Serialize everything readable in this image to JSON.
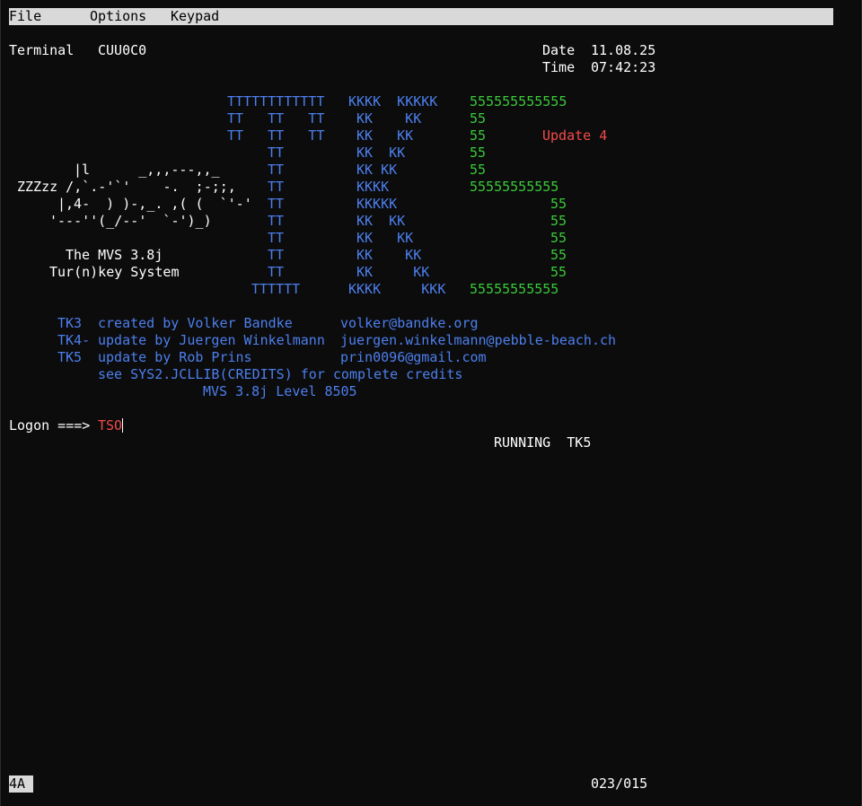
{
  "menu": {
    "items": [
      "File",
      "Options",
      "Keypad"
    ]
  },
  "header": {
    "terminal_label": "Terminal",
    "terminal_value": "CUU0C0",
    "date_label": "Date",
    "date_value": "11.08.25",
    "time_label": "Time",
    "time_value": "07:42:23"
  },
  "banner": {
    "tk_lines": [
      "TTTTTTTTTTTT",
      "TT   TT   TT",
      "TT   TT   TT",
      "TT",
      "TT",
      "TT",
      "TT",
      "TT",
      "TT",
      "TT",
      "TT",
      "TT",
      "TTTTTT"
    ],
    "k_lines": [
      "KKKK  KKKKK",
      "KK    KK",
      "KK   KK",
      "KK  KK",
      "KK KK",
      "KKKK",
      "KKKKK",
      "KK  KK",
      "KK   KK",
      "KK    KK",
      "KK     KK",
      "KKKK     KKK"
    ],
    "five_lines": [
      "555555555555",
      "55",
      "55",
      "55",
      "55",
      "55555555555",
      "55",
      "55",
      "55",
      "55",
      "55",
      "55555555555"
    ],
    "update_label": "Update 4",
    "ascii_art": [
      "|l      _,,,---,,_",
      "ZZZzz /,`.-'`'    -.  ;-;;,",
      "|,4-  ) )-,_. ,( (  `'-'",
      "'---''(_/--'  `-')_)"
    ],
    "system_line1": "The MVS 3.8j",
    "system_line2": "Tur(n)key System"
  },
  "credits": [
    {
      "tag": "TK3",
      "text": "created by Volker Bandke",
      "email": "volker@bandke.org"
    },
    {
      "tag": "TK4-",
      "text": "update by Juergen Winkelmann",
      "email": "juergen.winkelmann@pebble-beach.ch"
    },
    {
      "tag": "TK5",
      "text": "update by Rob Prins",
      "email": "prin0096@gmail.com"
    }
  ],
  "credits_note": "see SYS2.JCLLIB(CREDITS) for complete credits",
  "level_line": "MVS 3.8j Level 8505",
  "logon": {
    "label": "Logon ===>",
    "value": "TSO"
  },
  "status_line": "RUNNING  TK5",
  "footer": {
    "badge": "4A",
    "cursor_position": "023/015"
  },
  "colors": {
    "background": "#0c0c0c",
    "white": "#ffffff",
    "blue": "#4d7fee",
    "green": "#3ac93a",
    "red": "#f24a4a",
    "menubar": "#d9d9d9"
  }
}
